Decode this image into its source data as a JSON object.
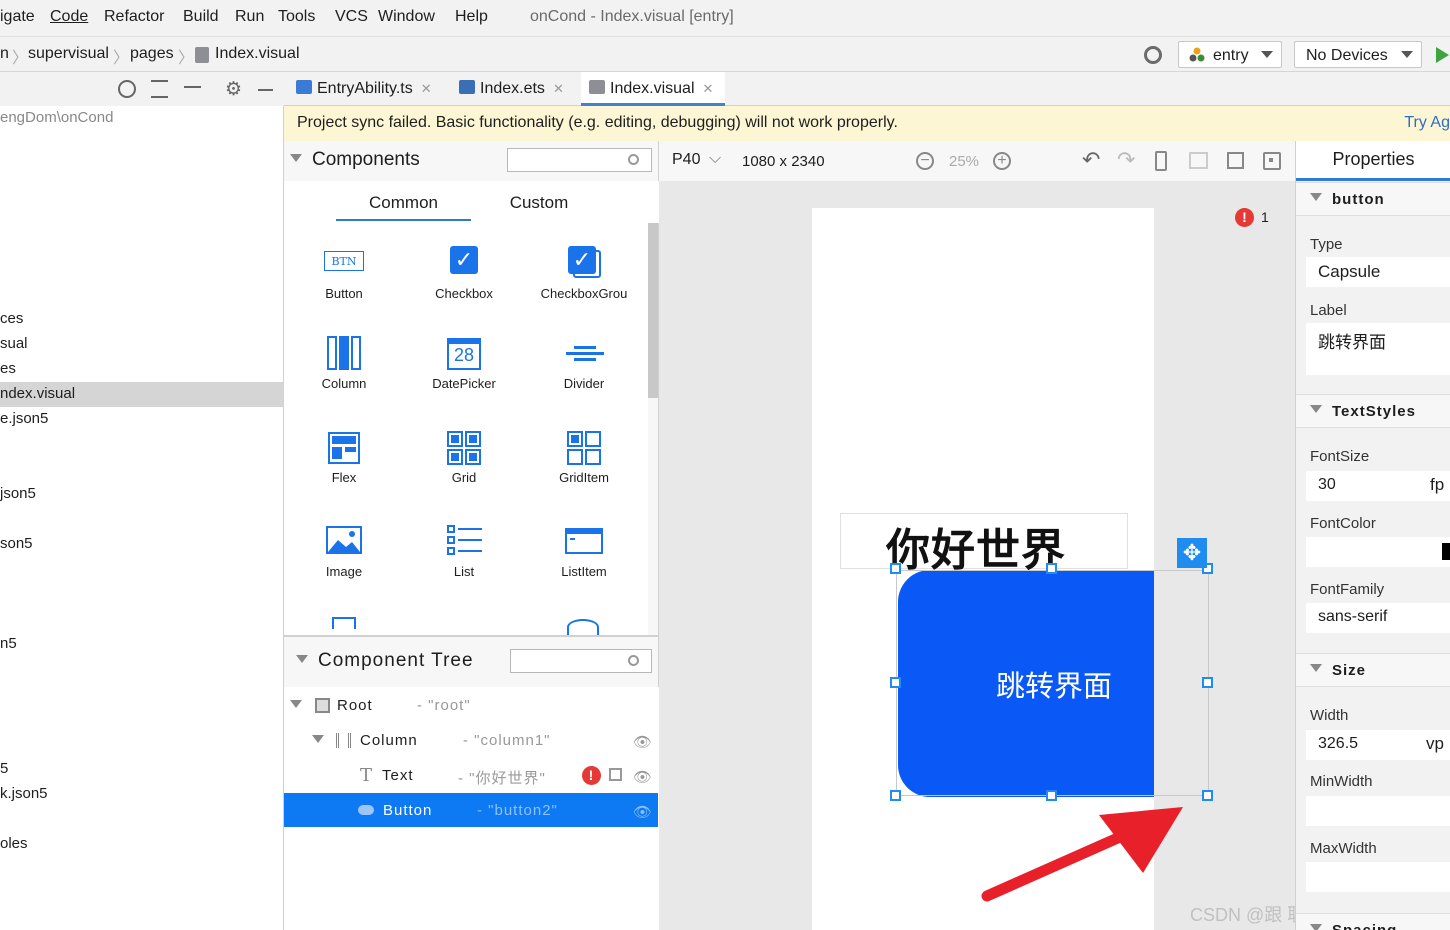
{
  "menu": [
    "igate",
    "Code",
    "Refactor",
    "Build",
    "Run",
    "Tools",
    "VCS",
    "Window",
    "Help"
  ],
  "window_title": "onCond - Index.visual [entry]",
  "breadcrumb": [
    "n",
    "supervisual",
    "pages",
    "Index.visual"
  ],
  "run_config": "entry",
  "device": "No Devices",
  "project_tree": {
    "path": "engDom\\onCond",
    "rows": [
      "ces",
      "sual",
      "es",
      "ndex.visual",
      "e.json5",
      "json5",
      "son5",
      "n5",
      "5",
      "k.json5",
      "oles"
    ]
  },
  "tabs": [
    {
      "label": "EntryAbility.ts",
      "icon": "ts-file-icon"
    },
    {
      "label": "Index.ets",
      "icon": "ets-file-icon"
    },
    {
      "label": "Index.visual",
      "icon": "visual-file-icon"
    }
  ],
  "warning": {
    "text": "Project sync failed. Basic functionality (e.g. editing, debugging) will not work properly.",
    "link": "Try Ag"
  },
  "components_panel": {
    "title": "Components",
    "tabs": [
      "Common",
      "Custom"
    ],
    "items": [
      "Button",
      "Checkbox",
      "CheckboxGrou",
      "Column",
      "DatePicker",
      "Divider",
      "Flex",
      "Grid",
      "GridItem",
      "Image",
      "List",
      "ListItem"
    ],
    "button_icon_text": "BTN",
    "datepicker_icon_text": "28"
  },
  "component_tree": {
    "title": "Component Tree",
    "rows": [
      {
        "type": "Root",
        "id": "- \"root\""
      },
      {
        "type": "Column",
        "id": "- \"column1\""
      },
      {
        "type": "Text",
        "id": "- \"你好世界\""
      },
      {
        "type": "Button",
        "id": "- \"button2\""
      }
    ]
  },
  "canvas": {
    "device": "P40",
    "resolution": "1080 x 2340",
    "zoom": "25%",
    "error_count": "1",
    "text_content": "你好世界",
    "button_label": "跳转界面",
    "button_color": "#0a59f7"
  },
  "properties": {
    "title": "Properties",
    "section_button": "button",
    "type_label": "Type",
    "type_value": "Capsule",
    "label_label": "Label",
    "label_value": "跳转界面",
    "section_text": "TextStyles",
    "fontsize_label": "FontSize",
    "fontsize_value": "30",
    "fontsize_unit": "fp",
    "fontcolor_label": "FontColor",
    "fontfamily_label": "FontFamily",
    "fontfamily_value": "sans-serif",
    "section_size": "Size",
    "width_label": "Width",
    "width_value": "326.5",
    "width_unit": "vp",
    "minwidth_label": "MinWidth",
    "maxwidth_label": "MaxWidth",
    "section_spacing": "Spacing"
  },
  "watermark": "CSDN @跟 耿瑞 卷出一片天"
}
